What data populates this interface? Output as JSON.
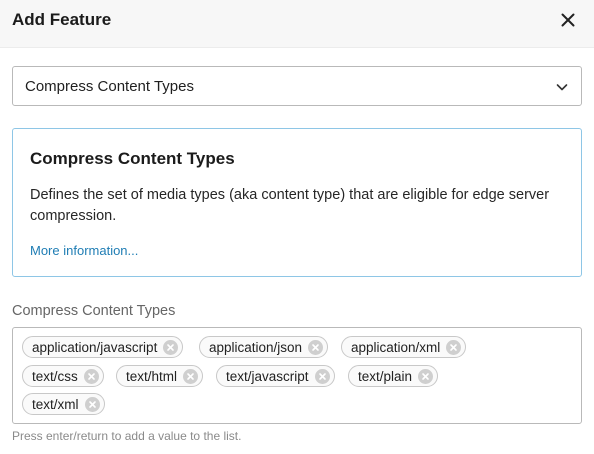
{
  "dialog": {
    "title": "Add Feature",
    "close_icon": "close-icon"
  },
  "feature_select": {
    "value": "Compress Content Types",
    "icon": "chevron-down-icon"
  },
  "info": {
    "heading": "Compress Content Types",
    "description": "Defines the set of media types (aka content type) that are eligible for edge server compression.",
    "link": "More information..."
  },
  "field": {
    "label": "Compress Content Types",
    "tags": [
      "application/javascript",
      "application/json",
      "application/xml",
      "text/css",
      "text/html",
      "text/javascript",
      "text/plain",
      "text/xml"
    ],
    "tag_remove_icon": "remove-circle-icon",
    "hint": "Press enter/return to add a value to the list."
  },
  "colors": {
    "link": "#1f7db4",
    "info_border": "#8ec6e6"
  }
}
